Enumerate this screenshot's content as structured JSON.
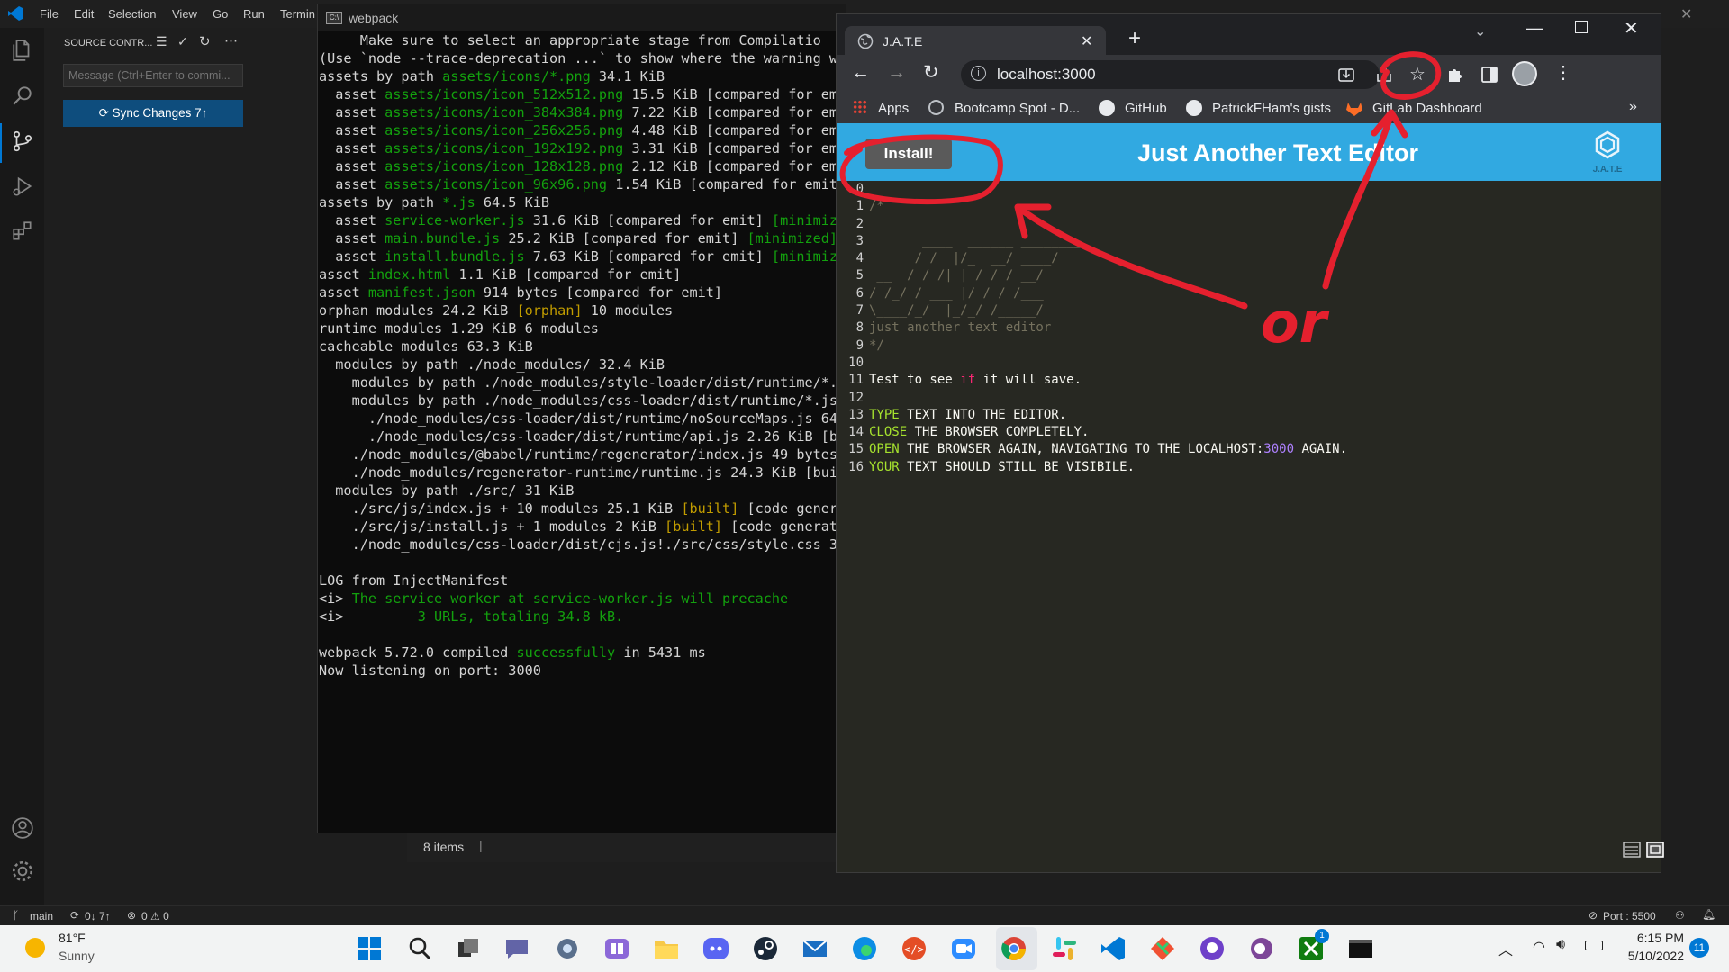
{
  "vscode": {
    "menu": [
      "File",
      "Edit",
      "Selection",
      "View",
      "Go",
      "Run",
      "Termin"
    ],
    "sidebar": {
      "title": "SOURCE CONTR...",
      "message_placeholder": "Message (Ctrl+Enter to commi...",
      "sync_label": "Sync Changes 7↑"
    },
    "status": {
      "branch": "main",
      "sync": "0↓ 7↑",
      "problems": "0 ⚠ 0",
      "port": "Port : 5500"
    }
  },
  "terminal": {
    "title": "webpack",
    "explorer_items": "8 items",
    "lines": [
      [
        [
          "     Make sure to select an appropriate stage from Compilatio",
          ""
        ]
      ],
      [
        [
          "(Use `node --trace-deprecation ...` to show where the warning wa",
          ""
        ]
      ],
      [
        [
          "assets by path ",
          ""
        ],
        [
          "assets/icons/*.png",
          "g"
        ],
        [
          " 34.1 KiB",
          ""
        ]
      ],
      [
        [
          "  asset ",
          ""
        ],
        [
          "assets/icons/icon_512x512.png",
          "g"
        ],
        [
          " 15.5 KiB [compared for emi",
          ""
        ]
      ],
      [
        [
          "  asset ",
          ""
        ],
        [
          "assets/icons/icon_384x384.png",
          "g"
        ],
        [
          " 7.22 KiB [compared for emi",
          ""
        ]
      ],
      [
        [
          "  asset ",
          ""
        ],
        [
          "assets/icons/icon_256x256.png",
          "g"
        ],
        [
          " 4.48 KiB [compared for emi",
          ""
        ]
      ],
      [
        [
          "  asset ",
          ""
        ],
        [
          "assets/icons/icon_192x192.png",
          "g"
        ],
        [
          " 3.31 KiB [compared for emi",
          ""
        ]
      ],
      [
        [
          "  asset ",
          ""
        ],
        [
          "assets/icons/icon_128x128.png",
          "g"
        ],
        [
          " 2.12 KiB [compared for emi",
          ""
        ]
      ],
      [
        [
          "  asset ",
          ""
        ],
        [
          "assets/icons/icon_96x96.png",
          "g"
        ],
        [
          " 1.54 KiB [compared for emit]",
          ""
        ]
      ],
      [
        [
          "assets by path ",
          ""
        ],
        [
          "*.js",
          "g"
        ],
        [
          " 64.5 KiB",
          ""
        ]
      ],
      [
        [
          "  asset ",
          ""
        ],
        [
          "service-worker.js",
          "g"
        ],
        [
          " 31.6 KiB [compared for emit] ",
          ""
        ],
        [
          "[minimize",
          "g"
        ]
      ],
      [
        [
          "  asset ",
          ""
        ],
        [
          "main.bundle.js",
          "g"
        ],
        [
          " 25.2 KiB [compared for emit] ",
          ""
        ],
        [
          "[minimized]",
          "g"
        ]
      ],
      [
        [
          "  asset ",
          ""
        ],
        [
          "install.bundle.js",
          "g"
        ],
        [
          " 7.63 KiB [compared for emit] ",
          ""
        ],
        [
          "[minimize",
          "g"
        ]
      ],
      [
        [
          "asset ",
          ""
        ],
        [
          "index.html",
          "g"
        ],
        [
          " 1.1 KiB [compared for emit]",
          ""
        ]
      ],
      [
        [
          "asset ",
          ""
        ],
        [
          "manifest.json",
          "g"
        ],
        [
          " 914 bytes [compared for emit]",
          ""
        ]
      ],
      [
        [
          "orphan modules 24.2 KiB ",
          ""
        ],
        [
          "[orphan]",
          "y"
        ],
        [
          " 10 modules",
          ""
        ]
      ],
      [
        [
          "runtime modules 1.29 KiB 6 modules",
          ""
        ]
      ],
      [
        [
          "cacheable modules 63.3 KiB",
          ""
        ]
      ],
      [
        [
          "  modules by path ./node_modules/ 32.4 KiB",
          ""
        ]
      ],
      [
        [
          "    modules by path ./node_modules/style-loader/dist/runtime/*.j",
          ""
        ]
      ],
      [
        [
          "    modules by path ./node_modules/css-loader/dist/runtime/*.js",
          ""
        ]
      ],
      [
        [
          "      ./node_modules/css-loader/dist/runtime/noSourceMaps.js 64",
          ""
        ]
      ],
      [
        [
          "      ./node_modules/css-loader/dist/runtime/api.js 2.26 KiB [bu",
          ""
        ]
      ],
      [
        [
          "    ./node_modules/@babel/runtime/regenerator/index.js 49 bytes",
          ""
        ]
      ],
      [
        [
          "    ./node_modules/regenerator-runtime/runtime.js 24.3 KiB [buil",
          ""
        ]
      ],
      [
        [
          "  modules by path ./src/ 31 KiB",
          ""
        ]
      ],
      [
        [
          "    ./src/js/index.js + 10 modules 25.1 KiB ",
          ""
        ],
        [
          "[built]",
          "y"
        ],
        [
          " [code genera",
          ""
        ]
      ],
      [
        [
          "    ./src/js/install.js + 1 modules 2 KiB ",
          ""
        ],
        [
          "[built]",
          "y"
        ],
        [
          " [code generate",
          ""
        ]
      ],
      [
        [
          "    ./node_modules/css-loader/dist/cjs.js!./src/css/style.css 3.",
          ""
        ]
      ],
      [
        [
          "",
          ""
        ]
      ],
      [
        [
          "LOG from InjectManifest",
          ""
        ]
      ],
      [
        [
          "<i> ",
          ""
        ],
        [
          "The service worker at service-worker.js will precache",
          "g"
        ]
      ],
      [
        [
          "<i>         ",
          ""
        ],
        [
          "3 URLs, totaling 34.8 kB.",
          "g"
        ]
      ],
      [
        [
          "",
          ""
        ]
      ],
      [
        [
          "webpack 5.72.0 compiled ",
          ""
        ],
        [
          "successfully",
          "g"
        ],
        [
          " in 5431 ms",
          ""
        ]
      ],
      [
        [
          "Now listening on port: 3000",
          ""
        ]
      ]
    ]
  },
  "browser": {
    "tab_title": "J.A.T.E",
    "url": "localhost:3000",
    "bookmarks": [
      "Apps",
      "Bootcamp Spot - D...",
      "GitHub",
      "PatrickFHam's gists",
      "GitLab Dashboard"
    ],
    "page": {
      "install_label": "Install!",
      "title": "Just Another Text Editor",
      "logo_text": "J.A.T.E",
      "editor_lines": [
        [
          [
            "",
            ""
          ]
        ],
        [
          [
            "/*",
            "cm"
          ]
        ],
        [
          [
            "",
            ""
          ]
        ],
        [
          [
            "       ____  ______ ________",
            "cm"
          ]
        ],
        [
          [
            "      / /  |/_  __/ ____/",
            "cm"
          ]
        ],
        [
          [
            " __  / / /| | / / / __/",
            "cm"
          ]
        ],
        [
          [
            "/ /_/ / ___ |/ / / /___",
            "cm"
          ]
        ],
        [
          [
            "\\____/_/  |_/_/ /_____/",
            "cm"
          ]
        ],
        [
          [
            "just another text editor",
            "cm"
          ]
        ],
        [
          [
            "*/",
            "cm"
          ]
        ],
        [
          [
            "",
            ""
          ]
        ],
        [
          [
            "Test to see ",
            ""
          ],
          [
            "if",
            "kw"
          ],
          [
            " it will save.",
            ""
          ]
        ],
        [
          [
            "",
            ""
          ]
        ],
        [
          [
            "TYPE",
            "kw2"
          ],
          [
            " TEXT INTO THE EDITOR.",
            ""
          ]
        ],
        [
          [
            "CLOSE",
            "kw2"
          ],
          [
            " THE BROWSER COMPLETELY.",
            ""
          ]
        ],
        [
          [
            "OPEN",
            "kw2"
          ],
          [
            " THE BROWSER AGAIN, NAVIGATING TO THE LOCALHOST:",
            ""
          ],
          [
            "3000",
            "num"
          ],
          [
            " AGAIN.",
            ""
          ]
        ],
        [
          [
            "YOUR",
            "kw2"
          ],
          [
            " TEXT SHOULD STILL BE VISIBILE.",
            ""
          ]
        ]
      ]
    }
  },
  "annotation": {
    "text": "or"
  },
  "taskbar": {
    "weather_temp": "81°F",
    "weather_desc": "Sunny",
    "time": "6:15 PM",
    "date": "5/10/2022",
    "notif_count": "11",
    "chat_badge": "1"
  },
  "colors": {
    "jate_header": "#31a9e1",
    "annotation": "#e5202e",
    "vscode_accent": "#0078d4"
  }
}
